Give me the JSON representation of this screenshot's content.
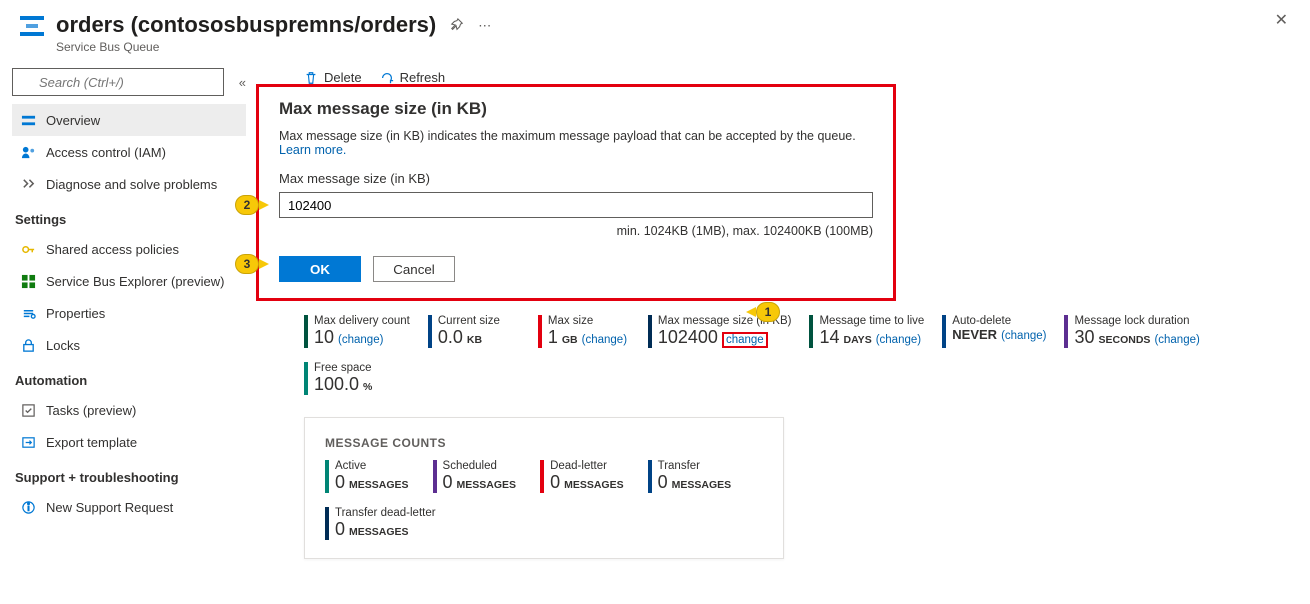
{
  "header": {
    "title": "orders (contososbuspremns/orders)",
    "subtitle": "Service Bus Queue"
  },
  "search": {
    "placeholder": "Search (Ctrl+/)"
  },
  "sidebar": {
    "items": [
      {
        "label": "Overview",
        "icon": "overview"
      },
      {
        "label": "Access control (IAM)",
        "icon": "identity"
      },
      {
        "label": "Diagnose and solve problems",
        "icon": "diagnose"
      }
    ],
    "settings_header": "Settings",
    "settings": [
      {
        "label": "Shared access policies",
        "icon": "key"
      },
      {
        "label": "Service Bus Explorer (preview)",
        "icon": "explorer"
      },
      {
        "label": "Properties",
        "icon": "properties"
      },
      {
        "label": "Locks",
        "icon": "lock"
      }
    ],
    "automation_header": "Automation",
    "automation": [
      {
        "label": "Tasks (preview)",
        "icon": "tasks"
      },
      {
        "label": "Export template",
        "icon": "export"
      }
    ],
    "support_header": "Support + troubleshooting",
    "support": [
      {
        "label": "New Support Request",
        "icon": "support"
      }
    ]
  },
  "toolbar": {
    "delete": "Delete",
    "refresh": "Refresh"
  },
  "dialog": {
    "title": "Max message size (in KB)",
    "description": "Max message size (in KB) indicates the maximum message payload that can be accepted by the queue. ",
    "learn_more": "Learn more.",
    "input_label": "Max message size (in KB)",
    "input_value": "102400",
    "hint": "min. 1024KB (1MB), max. 102400KB (100MB)",
    "ok": "OK",
    "cancel": "Cancel"
  },
  "callouts": {
    "c1": "1",
    "c2": "2",
    "c3": "3"
  },
  "stats": [
    {
      "label": "Max delivery count",
      "value": "10",
      "unit": "",
      "change": "(change)",
      "color": "#00533f"
    },
    {
      "label": "Current size",
      "value": "0.0",
      "unit": "KB",
      "change": "",
      "color": "#004386"
    },
    {
      "label": "Max size",
      "value": "1",
      "unit": "GB",
      "change": "(change)",
      "color": "#e3000f"
    },
    {
      "label": "Max message size (in KB)",
      "value": "102400",
      "unit": "",
      "change": "change",
      "boxed": true,
      "color": "#002c55"
    },
    {
      "label": "Message time to live",
      "value": "14",
      "unit": "DAYS",
      "change": "(change)",
      "color": "#00533f"
    },
    {
      "label": "Auto-delete",
      "value": "NEVER",
      "unit": "",
      "change": "(change)",
      "color": "#004386"
    },
    {
      "label": "Message lock duration",
      "value": "30",
      "unit": "SECONDS",
      "change": "(change)",
      "color": "#5c2e91"
    }
  ],
  "stats_row2": [
    {
      "label": "Free space",
      "value": "100.0",
      "unit": "%",
      "change": "",
      "color": "#008575"
    }
  ],
  "counts": {
    "title": "MESSAGE COUNTS",
    "items": [
      {
        "label": "Active",
        "value": "0",
        "unit": "MESSAGES",
        "color": "#008575"
      },
      {
        "label": "Scheduled",
        "value": "0",
        "unit": "MESSAGES",
        "color": "#5c2e91"
      },
      {
        "label": "Dead-letter",
        "value": "0",
        "unit": "MESSAGES",
        "color": "#e3000f"
      },
      {
        "label": "Transfer",
        "value": "0",
        "unit": "MESSAGES",
        "color": "#004386"
      },
      {
        "label": "Transfer dead-letter",
        "value": "0",
        "unit": "MESSAGES",
        "color": "#002c55"
      }
    ]
  }
}
